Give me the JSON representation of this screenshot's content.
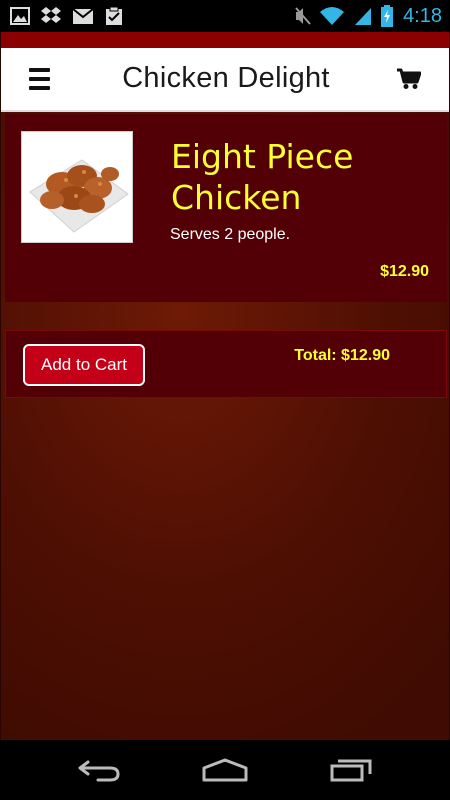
{
  "status_bar": {
    "time": "4:18",
    "left_icons": [
      "gallery-icon",
      "dropbox-icon",
      "gmail-icon",
      "clipboard-icon"
    ],
    "right_icons": [
      "mute-icon",
      "wifi-icon",
      "signal-icon",
      "battery-icon"
    ]
  },
  "header": {
    "title": "Chicken Delight",
    "menu_icon": "hamburger-menu-icon",
    "cart_icon": "shopping-cart-icon"
  },
  "product": {
    "name": "Eight Piece Chicken",
    "description": "Serves 2 people.",
    "price": "$12.90",
    "image": "fried-chicken-plate"
  },
  "cart": {
    "add_label": "Add to Cart",
    "total_label": "Total: $12.90"
  },
  "navbar": {
    "buttons": [
      "back-icon",
      "home-icon",
      "recent-apps-icon"
    ]
  },
  "colors": {
    "accent_yellow": "#ffff33",
    "brand_red": "#c40018",
    "card_bg": "#520006",
    "top_strip": "#8b0000",
    "time_blue": "#33b5e5"
  }
}
